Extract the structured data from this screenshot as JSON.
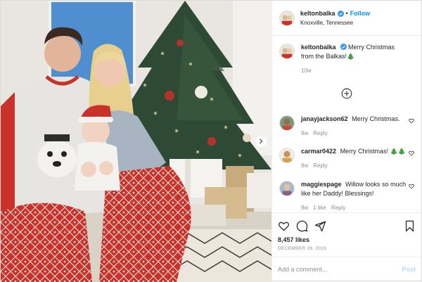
{
  "post": {
    "author": {
      "username": "keltonbalka",
      "verified": true,
      "follow_label": "Follow",
      "separator": "•",
      "location": "Knoxville, Tennessee"
    },
    "caption": {
      "username": "keltonbalka",
      "text": "Merry Christmas from the Balkas!🎄",
      "age": "10w"
    },
    "comments": [
      {
        "username": "janayjackson62",
        "text": "Merry Christmas.",
        "age": "9w",
        "likes": "",
        "reply_label": "Reply"
      },
      {
        "username": "carmar0422",
        "text": "Merry Christmas! 🎄🎄",
        "age": "9w",
        "likes": "",
        "reply_label": "Reply"
      },
      {
        "username": "maggiespage",
        "text": "Willow looks so much like her Daddy! Blessings!",
        "age": "9w",
        "likes": "1 like",
        "reply_label": "Reply"
      }
    ],
    "likes": "8,457 likes",
    "date": "DECEMBER 28, 2019",
    "add_comment": {
      "placeholder": "Add a comment...",
      "post_label": "Post"
    },
    "icons": [
      "heart-icon",
      "comment-icon",
      "share-icon",
      "bookmark-icon",
      "plus-circle-icon",
      "chevron-right-icon",
      "verified-badge-icon"
    ],
    "colors": {
      "accent": "#0095f6",
      "muted": "#8e8e8e",
      "post_disabled": "#b3dbff",
      "pajama_red": "#c8322a"
    }
  }
}
